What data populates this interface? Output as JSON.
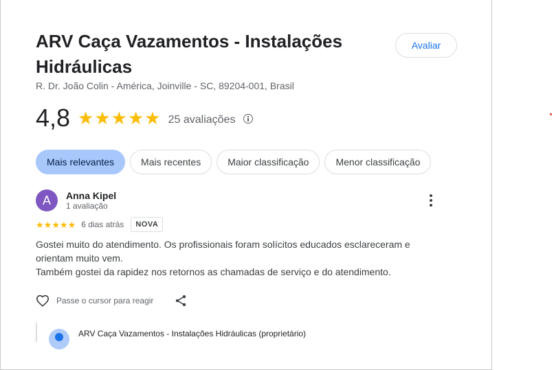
{
  "place": {
    "title": "ARV Caça Vazamentos - Instalações Hidráulicas",
    "address": "R. Dr. João Colin - América, Joinville - SC, 89204-001, Brasil",
    "rate_button": "Avaliar",
    "rating": "4,8",
    "rating_value": 4.8,
    "stars": [
      "★",
      "★",
      "★",
      "★",
      "★"
    ],
    "review_count": "25 avaliações"
  },
  "sort_chips": [
    {
      "label": "Mais relevantes",
      "selected": true
    },
    {
      "label": "Mais recentes",
      "selected": false
    },
    {
      "label": "Maior classificação",
      "selected": false
    },
    {
      "label": "Menor classificação",
      "selected": false
    }
  ],
  "review": {
    "avatar_letter": "A",
    "avatar_color": "#7e57c2",
    "name": "Anna Kipel",
    "meta": "1 avaliação",
    "stars": [
      "★",
      "★",
      "★",
      "★",
      "★"
    ],
    "star_count": 5,
    "date": "6 dias atrás",
    "badge": "NOVA",
    "text_line1": "Gostei muito do atendimento. Os profissionais foram solícitos educados esclareceram e orientam muito vem.",
    "text_line2": "Também gostei da rapidez nos retornos as chamadas de serviço e do atendimento.",
    "react_label": "Passe o cursor para reagir"
  },
  "owner_reply": {
    "name": "ARV Caça Vazamentos - Instalações Hidráulicas (proprietário)"
  },
  "colors": {
    "accent": "#1a73e8",
    "star": "#fbbc04",
    "selected_chip": "#a8c7fa"
  },
  "icons": [
    "info-icon",
    "more-vert-icon",
    "heart-icon",
    "share-icon"
  ]
}
